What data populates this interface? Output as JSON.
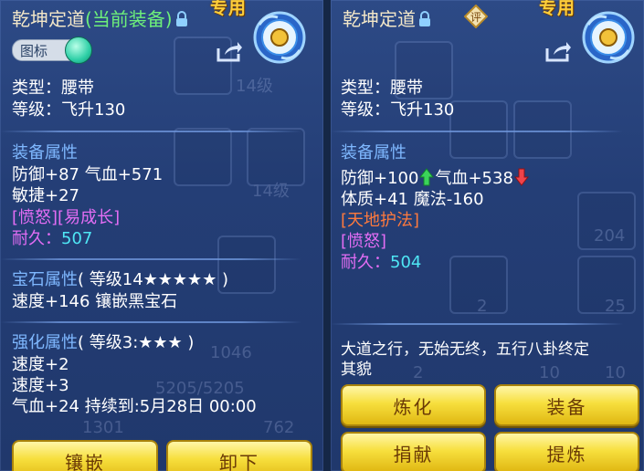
{
  "left": {
    "title_name": "乾坤定道",
    "title_status": "(当前装备)",
    "exclusive_tag": "专用",
    "toggle_label": "图标",
    "type_line": "类型：腰带",
    "level_line": "等级：飞升130",
    "equip_attr_header": "装备属性",
    "attr_line1": "防御+87 气血+571",
    "attr_line2": "敏捷+27",
    "special_tags": "[愤怒][易成长]",
    "durability_label": "耐久：",
    "durability_value": "507",
    "gem_header": "宝石属性",
    "gem_level": "( 等级14★★★★★ )",
    "gem_line": "速度+146 镶嵌黑宝石",
    "enhance_header": "强化属性",
    "enhance_level": "( 等级3:★★★ )",
    "enhance_line1": "速度+2",
    "enhance_line2": "速度+3",
    "enhance_line3": "气血+24   持续到:5月28日 00:00",
    "btn_inlay": "镶嵌",
    "btn_remove": "卸下"
  },
  "right": {
    "title_name": "乾坤定道",
    "rating_glyph": "评",
    "exclusive_tag": "专用",
    "type_line": "类型：腰带",
    "level_line": "等级：飞升130",
    "equip_attr_header": "装备属性",
    "attr_def": "防御+100",
    "attr_hp": "气血+538",
    "attr_line2": "体质+41 魔法-160",
    "special_tag1": "[天地护法]",
    "special_tag2": "[愤怒]",
    "durability_label": "耐久：",
    "durability_value": "504",
    "description": "大道之行，无始无终，五行八卦终定",
    "description2": "其貌",
    "btn_refine": "炼化",
    "btn_equip": "装备",
    "btn_donate": "捐献",
    "btn_extract": "提炼"
  },
  "background_numbers": [
    "14级",
    "14级",
    "204",
    "2",
    "25",
    "2",
    "10",
    "10",
    "5205/5205",
    "1301",
    "762",
    "1046"
  ],
  "colors": {
    "equipped_green": "#6ef07a",
    "section_blue": "#7fb8ff",
    "purple_tag": "#e36df4",
    "durability_cyan": "#4fe7f5",
    "orange_tag": "#ff7a3d",
    "button_gold": "#f7df3d"
  }
}
